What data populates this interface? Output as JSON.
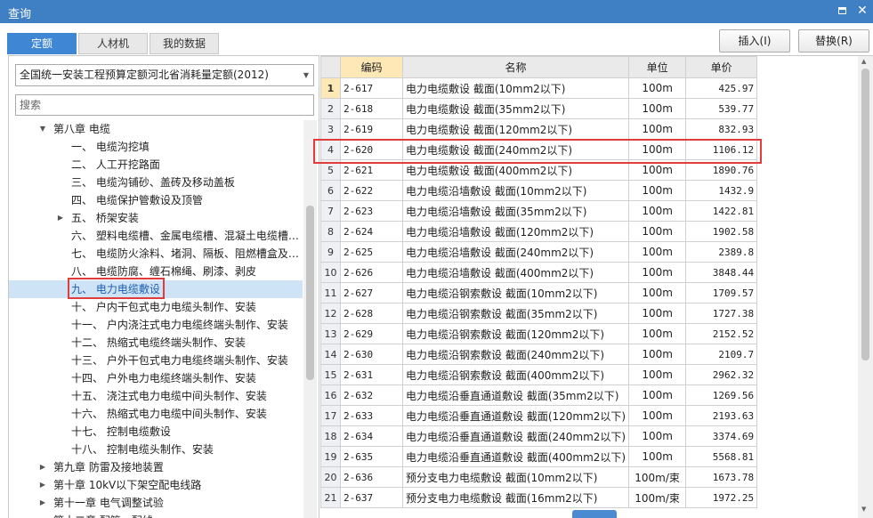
{
  "window": {
    "title": "查询"
  },
  "tabs": [
    {
      "label": "定额",
      "active": true
    },
    {
      "label": "人材机",
      "active": false
    },
    {
      "label": "我的数据",
      "active": false
    }
  ],
  "toolbar": {
    "insert_label": "插入(I)",
    "replace_label": "替换(R)"
  },
  "quota_library": {
    "selected": "全国统一安装工程预算定额河北省消耗量定额(2012)"
  },
  "search": {
    "placeholder": "搜索"
  },
  "tree": [
    {
      "label": "第八章 电缆",
      "level": 1,
      "toggle": "▼"
    },
    {
      "label": "一、 电缆沟挖填",
      "level": 2,
      "toggle": ""
    },
    {
      "label": "二、 人工开挖路面",
      "level": 2,
      "toggle": ""
    },
    {
      "label": "三、 电缆沟铺砂、盖砖及移动盖板",
      "level": 2,
      "toggle": ""
    },
    {
      "label": "四、 电缆保护管敷设及顶管",
      "level": 2,
      "toggle": ""
    },
    {
      "label": "五、 桥架安装",
      "level": 2,
      "toggle": "▶"
    },
    {
      "label": "六、 塑料电缆槽、金属电缆槽、混凝土电缆槽…",
      "level": 2,
      "toggle": ""
    },
    {
      "label": "七、 电缆防火涂料、堵洞、隔板、阻燃槽盒及…",
      "level": 2,
      "toggle": ""
    },
    {
      "label": "八、 电缆防腐、缠石棉绳、刷漆、剥皮",
      "level": 2,
      "toggle": ""
    },
    {
      "label": "九、 电力电缆敷设",
      "level": 2,
      "toggle": "",
      "selected": true
    },
    {
      "label": "十、 户内干包式电力电缆头制作、安装",
      "level": 2,
      "toggle": ""
    },
    {
      "label": "十一、 户内浇注式电力电缆终端头制作、安装",
      "level": 2,
      "toggle": ""
    },
    {
      "label": "十二、 热缩式电缆终端头制作、安装",
      "level": 2,
      "toggle": ""
    },
    {
      "label": "十三、 户外干包式电力电缆终端头制作、安装",
      "level": 2,
      "toggle": ""
    },
    {
      "label": "十四、 户外电力电缆终端头制作、安装",
      "level": 2,
      "toggle": ""
    },
    {
      "label": "十五、 浇注式电力电缆中间头制作、安装",
      "level": 2,
      "toggle": ""
    },
    {
      "label": "十六、 热缩式电力电缆中间头制作、安装",
      "level": 2,
      "toggle": ""
    },
    {
      "label": "十七、 控制电缆敷设",
      "level": 2,
      "toggle": ""
    },
    {
      "label": "十八、 控制电缆头制作、安装",
      "level": 2,
      "toggle": ""
    },
    {
      "label": "第九章 防雷及接地装置",
      "level": 1,
      "toggle": "▶"
    },
    {
      "label": "第十章 10kV以下架空配电线路",
      "level": 1,
      "toggle": "▶"
    },
    {
      "label": "第十一章 电气调整试验",
      "level": 1,
      "toggle": "▶"
    },
    {
      "label": "第十二章 配管、配线",
      "level": 1,
      "toggle": "▶"
    }
  ],
  "table": {
    "headers": [
      "编码",
      "名称",
      "单位",
      "单价"
    ],
    "rows": [
      {
        "no": "1",
        "code": "2-617",
        "name": "电力电缆敷设 截面(10mm2以下)",
        "unit": "100m",
        "price": "425.97"
      },
      {
        "no": "2",
        "code": "2-618",
        "name": "电力电缆敷设 截面(35mm2以下)",
        "unit": "100m",
        "price": "539.77"
      },
      {
        "no": "3",
        "code": "2-619",
        "name": "电力电缆敷设 截面(120mm2以下)",
        "unit": "100m",
        "price": "832.93"
      },
      {
        "no": "4",
        "code": "2-620",
        "name": "电力电缆敷设 截面(240mm2以下)",
        "unit": "100m",
        "price": "1106.12"
      },
      {
        "no": "5",
        "code": "2-621",
        "name": "电力电缆敷设 截面(400mm2以下)",
        "unit": "100m",
        "price": "1890.76"
      },
      {
        "no": "6",
        "code": "2-622",
        "name": "电力电缆沿墙敷设 截面(10mm2以下)",
        "unit": "100m",
        "price": "1432.9"
      },
      {
        "no": "7",
        "code": "2-623",
        "name": "电力电缆沿墙敷设 截面(35mm2以下)",
        "unit": "100m",
        "price": "1422.81"
      },
      {
        "no": "8",
        "code": "2-624",
        "name": "电力电缆沿墙敷设 截面(120mm2以下)",
        "unit": "100m",
        "price": "1902.58"
      },
      {
        "no": "9",
        "code": "2-625",
        "name": "电力电缆沿墙敷设 截面(240mm2以下)",
        "unit": "100m",
        "price": "2389.8"
      },
      {
        "no": "10",
        "code": "2-626",
        "name": "电力电缆沿墙敷设 截面(400mm2以下)",
        "unit": "100m",
        "price": "3848.44"
      },
      {
        "no": "11",
        "code": "2-627",
        "name": "电力电缆沿钢索敷设 截面(10mm2以下)",
        "unit": "100m",
        "price": "1709.57"
      },
      {
        "no": "12",
        "code": "2-628",
        "name": "电力电缆沿钢索敷设 截面(35mm2以下)",
        "unit": "100m",
        "price": "1727.38"
      },
      {
        "no": "13",
        "code": "2-629",
        "name": "电力电缆沿钢索敷设 截面(120mm2以下)",
        "unit": "100m",
        "price": "2152.52"
      },
      {
        "no": "14",
        "code": "2-630",
        "name": "电力电缆沿钢索敷设 截面(240mm2以下)",
        "unit": "100m",
        "price": "2109.7"
      },
      {
        "no": "15",
        "code": "2-631",
        "name": "电力电缆沿钢索敷设 截面(400mm2以下)",
        "unit": "100m",
        "price": "2962.32"
      },
      {
        "no": "16",
        "code": "2-632",
        "name": "电力电缆沿垂直通道敷设 截面(35mm2以下)",
        "unit": "100m",
        "price": "1269.56"
      },
      {
        "no": "17",
        "code": "2-633",
        "name": "电力电缆沿垂直通道敷设 截面(120mm2以下)",
        "unit": "100m",
        "price": "2193.63"
      },
      {
        "no": "18",
        "code": "2-634",
        "name": "电力电缆沿垂直通道敷设 截面(240mm2以下)",
        "unit": "100m",
        "price": "3374.69"
      },
      {
        "no": "19",
        "code": "2-635",
        "name": "电力电缆沿垂直通道敷设 截面(400mm2以下)",
        "unit": "100m",
        "price": "5568.81"
      },
      {
        "no": "20",
        "code": "2-636",
        "name": "预分支电力电缆敷设 截面(10mm2以下)",
        "unit": "100m/束",
        "price": "1673.78"
      },
      {
        "no": "21",
        "code": "2-637",
        "name": "预分支电力电缆敷设 截面(16mm2以下)",
        "unit": "100m/束",
        "price": "1972.25"
      }
    ]
  }
}
